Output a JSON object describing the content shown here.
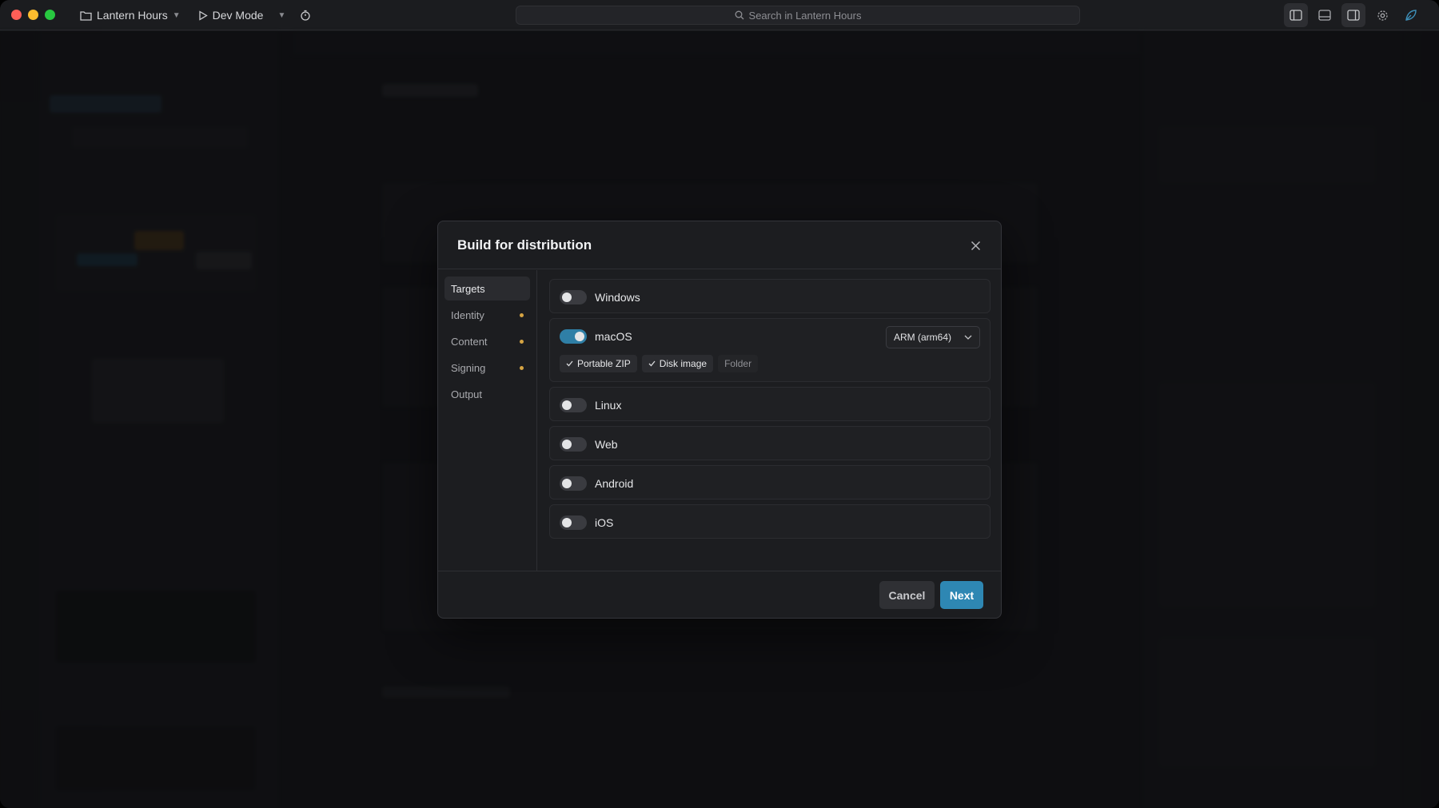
{
  "titlebar": {
    "project_name": "Lantern Hours",
    "mode_label": "Dev Mode",
    "search_placeholder": "Search in Lantern Hours"
  },
  "modal": {
    "title": "Build for distribution",
    "nav": [
      {
        "label": "Targets",
        "active": true,
        "dot": false
      },
      {
        "label": "Identity",
        "active": false,
        "dot": true
      },
      {
        "label": "Content",
        "active": false,
        "dot": true
      },
      {
        "label": "Signing",
        "active": false,
        "dot": true
      },
      {
        "label": "Output",
        "active": false,
        "dot": false
      }
    ],
    "targets": {
      "windows": {
        "label": "Windows",
        "enabled": false
      },
      "macos": {
        "label": "macOS",
        "enabled": true,
        "arch": "ARM (arm64)",
        "formats": [
          {
            "label": "Portable ZIP",
            "selected": true
          },
          {
            "label": "Disk image",
            "selected": true
          },
          {
            "label": "Folder",
            "selected": false
          }
        ]
      },
      "linux": {
        "label": "Linux",
        "enabled": false
      },
      "web": {
        "label": "Web",
        "enabled": false
      },
      "android": {
        "label": "Android",
        "enabled": false
      },
      "ios": {
        "label": "iOS",
        "enabled": false
      }
    },
    "cancel_label": "Cancel",
    "next_label": "Next"
  },
  "colors": {
    "accent": "#2e87b3",
    "toggle_on": "#2f7fa6",
    "pending_dot": "#d6a443"
  }
}
